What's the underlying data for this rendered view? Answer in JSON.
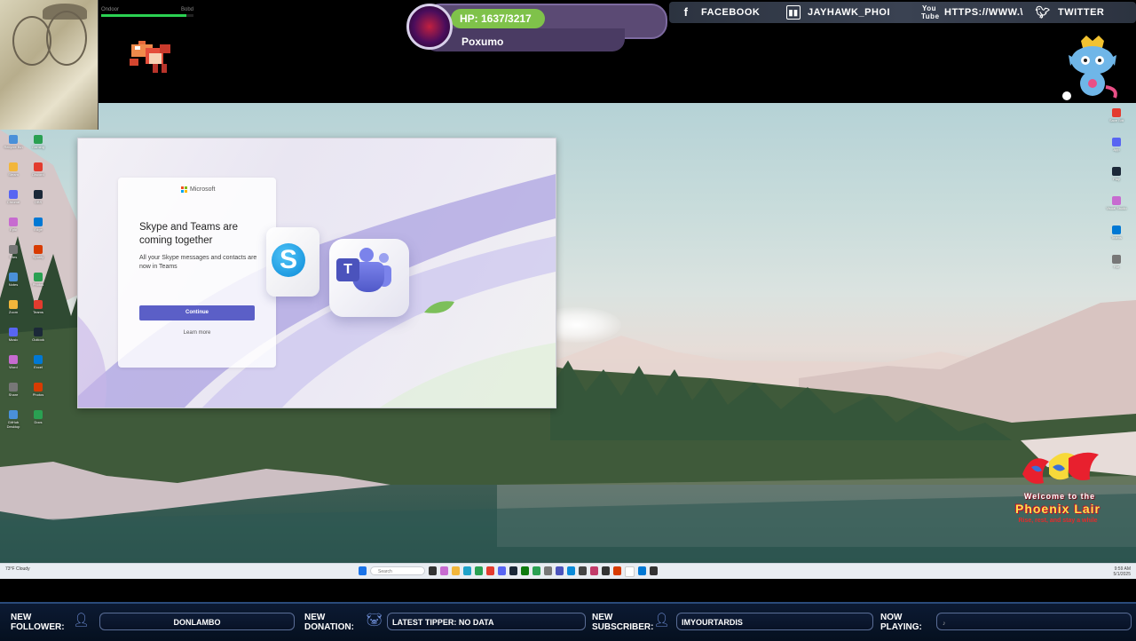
{
  "overlay": {
    "hp_text": "HP: 1637/3217",
    "hp_fraction": 0.509,
    "monster_name": "Poxumo",
    "mini_bar": {
      "left_label": "Ondoor",
      "right_label": "Bobd",
      "fill_fraction": 0.92
    },
    "social": {
      "facebook": "FACEBOOK",
      "twitch": "JAYHAWK_PHOI",
      "youtube": "HTTPS://WWW.\\",
      "twitter": "TWITTER"
    },
    "colors": {
      "hp_green": "#7fc24a",
      "panel_purple": "#5b4a74",
      "social_bg": "#3a4252"
    },
    "icons": {
      "facebook": "facebook-icon",
      "twitch": "twitch-icon",
      "youtube": "youtube-icon",
      "twitter": "twitter-icon"
    }
  },
  "promo_window": {
    "brand": "Microsoft",
    "title": "Skype and Teams are coming together",
    "body": "All your Skype messages and contacts are now in Teams",
    "continue_label": "Continue",
    "learn_more_label": "Learn more",
    "colors": {
      "button": "#5b5fc7",
      "skype_blue": "#0a8ad8",
      "teams_purple": "#5059c9"
    },
    "icons": {
      "skype": "skype-logo-icon",
      "teams": "teams-logo-icon",
      "leaf": "leaf-icon"
    }
  },
  "phoenix_logo": {
    "line1": "Welcome to the",
    "line2": "Phoenix Lair",
    "line3": "Rise, rest, and stay a while"
  },
  "taskbar": {
    "search_placeholder": "Search",
    "weather": "73°F Cloudy",
    "time": "9:59 AM",
    "date": "5/1/2025"
  },
  "desktop_icons_left": [
    "Recycle Bin",
    "Gaming",
    "Steam",
    "Discord",
    "Chrome",
    "OBS",
    "Epic",
    "Edge",
    "Files",
    "Spotify",
    "Notes",
    "Photos",
    "Zoom",
    "Teams",
    "Music",
    "Outlook",
    "Word",
    "Excel",
    "Share",
    "Photos",
    "GitHub Desktop",
    "Docs"
  ],
  "desktop_icons_right": [
    "Save Bitt",
    "App",
    "Play",
    "Visual Studio",
    "Teams",
    "File"
  ],
  "bottom_bar": {
    "new_follower_label": "NEW FOLLOWER:",
    "new_follower_value": "DONLAMBO",
    "new_donation_label": "NEW DONATION:",
    "new_donation_value": "LATEST TIPPER: NO DATA",
    "new_subscriber_label": "NEW SUBSCRIBER:",
    "new_subscriber_value": "IMYOURTARDIS",
    "now_playing_label": "NOW PLAYING:",
    "now_playing_value": "",
    "icons": {
      "follower": "user-plus-icon",
      "donation": "piggy-bank-icon",
      "subscriber": "user-star-icon",
      "playing": "music-icon"
    }
  }
}
